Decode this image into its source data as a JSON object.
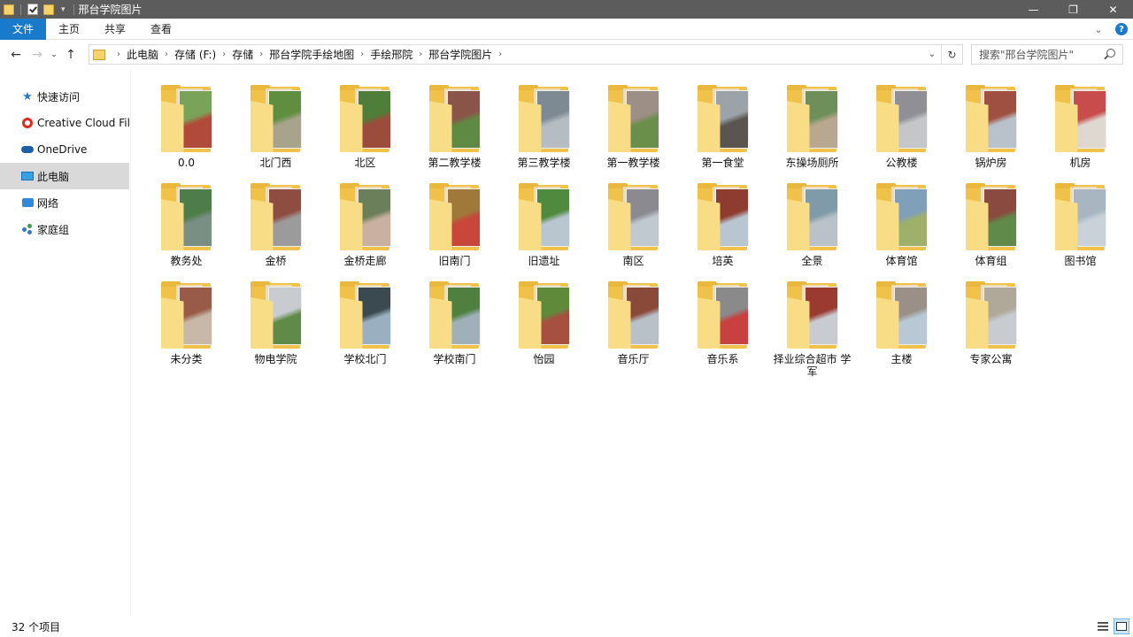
{
  "window": {
    "title": "邢台学院图片"
  },
  "ribbon": {
    "tabs": [
      "文件",
      "主页",
      "共享",
      "查看"
    ]
  },
  "address": {
    "crumbs": [
      "此电脑",
      "存储 (F:)",
      "存储",
      "邢台学院手绘地图",
      "手绘邢院",
      "邢台学院图片"
    ],
    "search_placeholder": "搜索\"邢台学院图片\""
  },
  "sidebar": {
    "items": [
      {
        "label": "快速访问",
        "icon": "star-icon"
      },
      {
        "label": "Creative Cloud Files",
        "icon": "creative-cloud-icon"
      },
      {
        "label": "OneDrive",
        "icon": "onedrive-icon"
      },
      {
        "label": "此电脑",
        "icon": "computer-icon",
        "selected": true
      },
      {
        "label": "网络",
        "icon": "network-icon"
      },
      {
        "label": "家庭组",
        "icon": "homegroup-icon"
      }
    ]
  },
  "folders": [
    {
      "name": "0.0",
      "colors": [
        "#7aa35a",
        "#b24a3a"
      ]
    },
    {
      "name": "北门西",
      "colors": [
        "#5f8f3e",
        "#a8a48c"
      ]
    },
    {
      "name": "北区",
      "colors": [
        "#4f7d3a",
        "#9c4c3c"
      ]
    },
    {
      "name": "第二教学楼",
      "colors": [
        "#8a5448",
        "#5e8a44"
      ]
    },
    {
      "name": "第三教学楼",
      "colors": [
        "#7d8a94",
        "#b5bcc2"
      ]
    },
    {
      "name": "第一教学楼",
      "colors": [
        "#9b8f86",
        "#6a8f4a"
      ]
    },
    {
      "name": "第一食堂",
      "colors": [
        "#9ba2a8",
        "#5a5550"
      ]
    },
    {
      "name": "东操场厕所",
      "colors": [
        "#6f8f5a",
        "#b8a890"
      ]
    },
    {
      "name": "公教楼",
      "colors": [
        "#8f8f95",
        "#c4c6c8"
      ]
    },
    {
      "name": "锅炉房",
      "colors": [
        "#a05040",
        "#b9c2cb"
      ]
    },
    {
      "name": "机房",
      "colors": [
        "#c84c4c",
        "#ded8d0"
      ]
    },
    {
      "name": "教务处",
      "colors": [
        "#4f7d4a",
        "#7a8f84"
      ]
    },
    {
      "name": "金桥",
      "colors": [
        "#8f4c40",
        "#9b9b9b"
      ]
    },
    {
      "name": "金桥走廊",
      "colors": [
        "#6a7f5a",
        "#c9b0a0"
      ]
    },
    {
      "name": "旧南门",
      "colors": [
        "#a0783a",
        "#c8463a"
      ]
    },
    {
      "name": "旧遗址",
      "colors": [
        "#4f8a3e",
        "#b8c6d0"
      ]
    },
    {
      "name": "南区",
      "colors": [
        "#8a8a90",
        "#c0c8d0"
      ]
    },
    {
      "name": "培英",
      "colors": [
        "#8f3c30",
        "#b8c6d0"
      ]
    },
    {
      "name": "全景",
      "colors": [
        "#7f9aa8",
        "#b8c2c8"
      ]
    },
    {
      "name": "体育馆",
      "colors": [
        "#7fa0b8",
        "#9fb06a"
      ]
    },
    {
      "name": "体育组",
      "colors": [
        "#8a4a40",
        "#5f8a4a"
      ]
    },
    {
      "name": "图书馆",
      "colors": [
        "#a8b6c2",
        "#c8d2d8"
      ]
    },
    {
      "name": "未分类",
      "colors": [
        "#9a5a48",
        "#c8b8a8"
      ]
    },
    {
      "name": "物电学院",
      "colors": [
        "#c8ccd0",
        "#5f8a48"
      ]
    },
    {
      "name": "学校北门",
      "colors": [
        "#3a4a50",
        "#9ab0c0"
      ]
    },
    {
      "name": "学校南门",
      "colors": [
        "#4f8040",
        "#a0b0b8"
      ]
    },
    {
      "name": "怡园",
      "colors": [
        "#5f8a3a",
        "#a85040"
      ]
    },
    {
      "name": "音乐厅",
      "colors": [
        "#8a4a3a",
        "#b8c0c8"
      ]
    },
    {
      "name": "音乐系",
      "colors": [
        "#8a8a8a",
        "#c84040"
      ]
    },
    {
      "name": "择业综合超市 学军",
      "colors": [
        "#9a3a30",
        "#c8ccd0"
      ]
    },
    {
      "name": "主楼",
      "colors": [
        "#9a9088",
        "#b8c8d4"
      ]
    },
    {
      "name": "专家公寓",
      "colors": [
        "#b0a898",
        "#c8ccd0"
      ]
    }
  ],
  "status": {
    "count_text": "32 个项目"
  }
}
